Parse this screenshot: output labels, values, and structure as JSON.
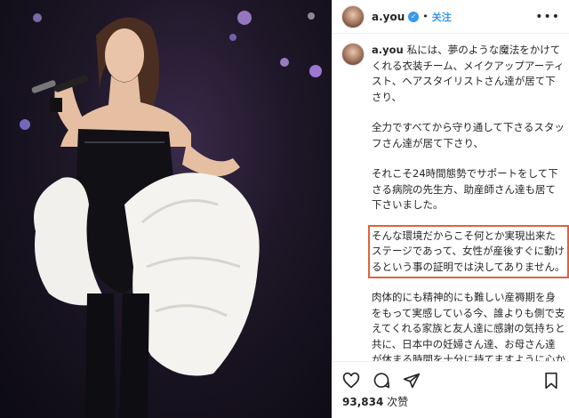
{
  "post": {
    "username": "a.you",
    "verified_mark": "✓",
    "separator": "•",
    "follow_label": "关注",
    "more_icon": "more-icon",
    "caption_user": "a.you",
    "paragraphs": [
      "私には、夢のような魔法をかけてくれる衣装チーム、メイクアップアーティスト、ヘアスタイリストさん達が居て下さり、",
      "全力ですべてから守り通して下さるスタッフさん達が居て下さり、",
      "それこそ24時間態勢でサポートをして下さる病院の先生方、助産師さん達も居て下さいました。",
      "そんな環境だからこそ何とか実現出来たステージであって、女性が産後すぐに動けるという事の証明では決してありません。",
      "肉体的にも精神的にも難しい産褥期を身をもって実感している今、誰よりも側で支えてくれる家族と友人達に感謝の気持ちと共に、日本中の妊婦さん達、お母さん達が休まる時間を十分に持てますように心から願っています。"
    ],
    "likes_count": "93,834",
    "likes_unit": "次赞"
  },
  "colors": {
    "highlight": "#e0623c",
    "link_blue": "#3897f0"
  }
}
